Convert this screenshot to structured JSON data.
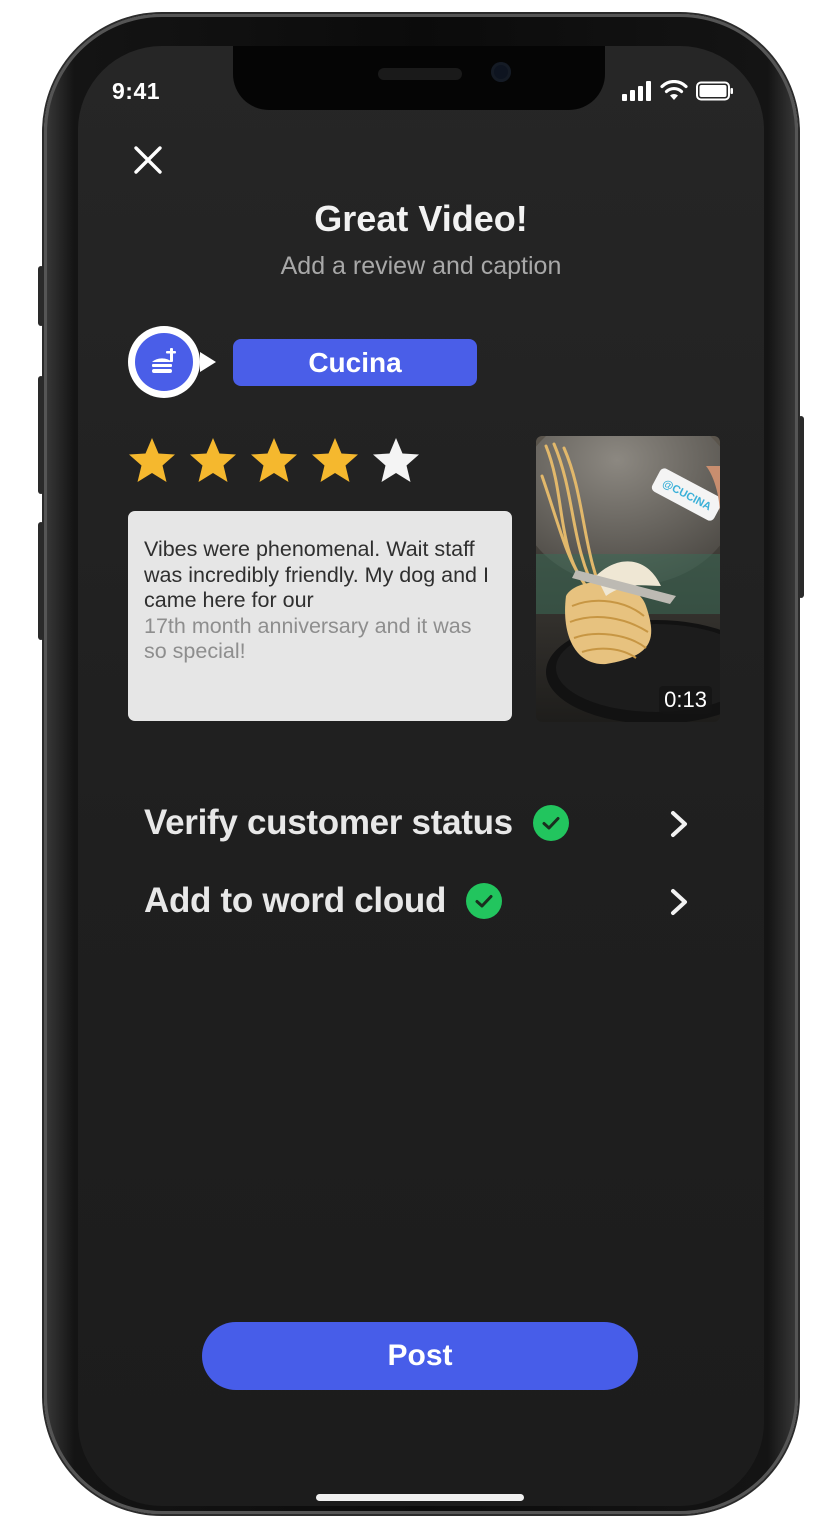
{
  "status_bar": {
    "time": "9:41"
  },
  "header": {
    "close_icon": "close-icon",
    "title": "Great Video!",
    "subtitle": "Add a review and caption"
  },
  "venue": {
    "name": "Cucina",
    "icon": "restaurant-burger-icon"
  },
  "rating": {
    "value": 4,
    "max": 5
  },
  "review": {
    "text_visible": "Vibes were phenomenal. Wait staff was incredibly friendly. My dog and I came here for our",
    "text_faded": "17th month anniversary and it was so special!"
  },
  "video": {
    "duration": "0:13",
    "sticker_text": "@CUCINA"
  },
  "options": [
    {
      "label": "Verify customer status",
      "checked": true
    },
    {
      "label": "Add to word cloud",
      "checked": true
    }
  ],
  "actions": {
    "post_label": "Post"
  },
  "colors": {
    "accent": "#475de9",
    "check_green": "#22c55e",
    "star_gold": "#f5b82e",
    "background": "#1f1f1f"
  }
}
